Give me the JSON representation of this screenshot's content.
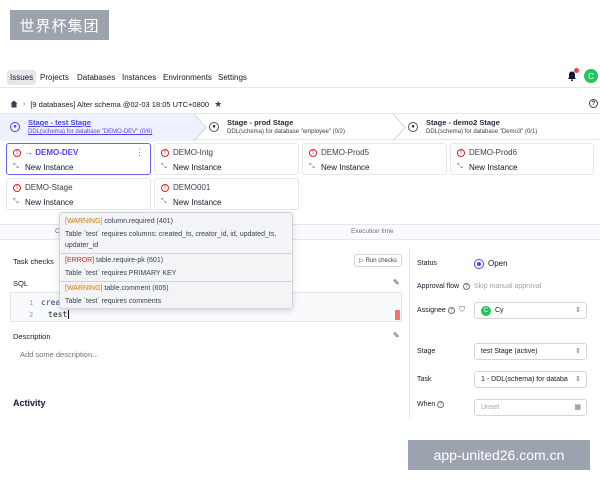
{
  "watermark_top": "世界杯集团",
  "watermark_bottom": "app-united26.com.cn",
  "nav": {
    "items": [
      "Issues",
      "Projects",
      "Databases",
      "Instances",
      "Environments",
      "Settings"
    ],
    "avatar_initial": "C"
  },
  "breadcrumb": {
    "title": "[9 databases] Alter schema @02-03 18:05 UTC+0800"
  },
  "stages": [
    {
      "title": "Stage - test Stage",
      "sub": "DDL(schema) for database \"DEMO-DEV\" (0/6)",
      "active": true
    },
    {
      "title": "Stage - prod Stage",
      "sub": "DDL(schema) for database \"employee\" (0/2)",
      "active": false
    },
    {
      "title": "Stage - demo2 Stage",
      "sub": "DDL(schema) for database \"Demo3\" (0/1)",
      "active": false
    }
  ],
  "tasks": [
    {
      "name": "→ DEMO-DEV",
      "status": "New Instance",
      "active": true
    },
    {
      "name": "DEMO-Intg",
      "status": "New Instance",
      "active": false
    },
    {
      "name": "DEMO-Prod5",
      "status": "New Instance",
      "active": false
    },
    {
      "name": "DEMO-Prod6",
      "status": "New Instance",
      "active": false
    },
    {
      "name": "DEMO-Stage",
      "status": "New Instance",
      "active": false
    },
    {
      "name": "DEMO001",
      "status": "New Instance",
      "active": false
    }
  ],
  "tabs": {
    "left": "C",
    "right": "Execution time"
  },
  "tooltip": [
    {
      "tag": "[WARNING]",
      "rule": "column.required (401)",
      "message": "Table `test` requires columns: created_ts, creator_id, id, updated_ts,",
      "message2": "updater_id"
    },
    {
      "tag": "[ERROR]",
      "rule": "table.require-pk (601)",
      "message": "Table `test` requires PRIMARY KEY"
    },
    {
      "tag": "[WARNING]",
      "rule": "table.comment (605)",
      "message": "Table `test` requires comments"
    }
  ],
  "main": {
    "task_checks_label": "Task checks",
    "run_checks_label": "Run checks",
    "sql_label": "SQL",
    "sql_lines": [
      {
        "num": "1",
        "text": "creat"
      },
      {
        "num": "2",
        "text": "test"
      }
    ],
    "description_label": "Description",
    "description_placeholder": "Add some description...",
    "activity_label": "Activity"
  },
  "sidebar": {
    "status_label": "Status",
    "status_value": "Open",
    "approval_label": "Approval flow",
    "approval_value": "Skip manual approval",
    "assignee_label": "Assignee",
    "assignee_initial": "C",
    "assignee_value": "Cy",
    "stage_label": "Stage",
    "stage_value": "test Stage (active)",
    "task_label": "Task",
    "task_value": "1 - DDL(schema) for databa",
    "when_label": "When",
    "when_value": "Unset"
  }
}
